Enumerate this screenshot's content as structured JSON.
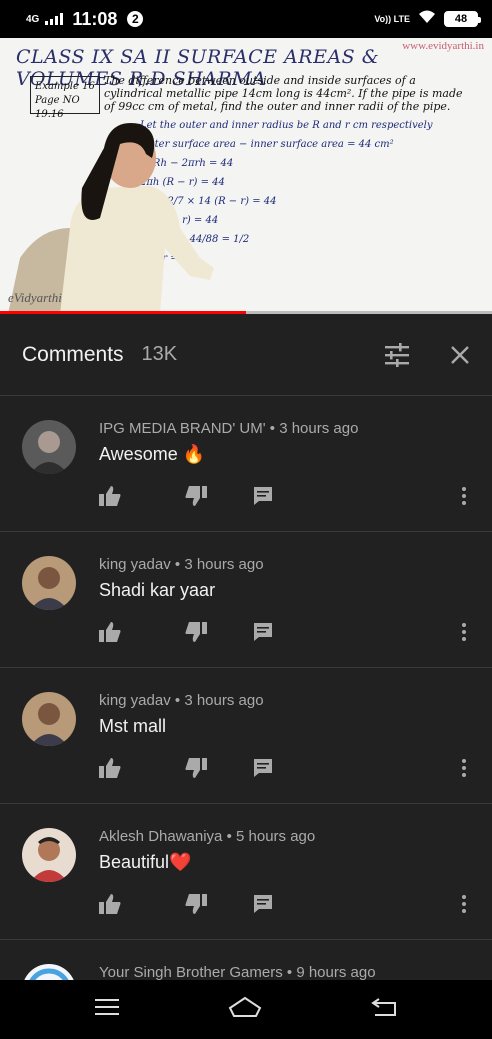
{
  "status_bar": {
    "network": "4G",
    "time": "11:08",
    "notification_count": "2",
    "volte": "Vo)) LTE",
    "battery": "48"
  },
  "video": {
    "board_title": "CLASS IX  SA II  SURFACE AREAS & VOLUMES  R.D SHARMA",
    "watermark": "www.evidyarthi.in",
    "example_label": "Example 16",
    "page_label": "Page NO 19.16",
    "question": "The difference between outside and inside surfaces of a cylindrical metallic pipe 14cm long is 44cm². If the pipe is made of 99cc cm of metal, find the outer and inner radii of the pipe.",
    "work_lines": [
      "Let the outer and inner radius be R and r cm respectively",
      "Outer surface area − inner surface area = 44 cm²",
      "2πRh − 2πrh = 44",
      "2πh (R − r) = 44",
      "2 × 22/7 × 14 (R − r) = 44",
      "88 (R − r) = 44",
      "(R − r) = 44/88 = 1/2",
      "R − r = 1/2"
    ],
    "logo": "eVidyarthi",
    "progress": 0.5
  },
  "comments": {
    "title": "Comments",
    "count": "13K",
    "items": [
      {
        "author": "IPG MEDIA BRAND' UM'",
        "time": "3 hours ago",
        "text": "Awesome 🔥",
        "avatar_color": "#8a8a8a"
      },
      {
        "author": "king yadav",
        "time": "3 hours ago",
        "text": "Shadi kar yaar",
        "avatar_color": "#b89a78"
      },
      {
        "author": "king yadav",
        "time": "3 hours ago",
        "text": "Mst mall",
        "avatar_color": "#b89a78"
      },
      {
        "author": "Aklesh Dhawaniya",
        "time": "5 hours ago",
        "text": "Beautiful❤️",
        "avatar_color": "#c07860"
      },
      {
        "author": "Your Singh Brother Gamers",
        "time": "9 hours ago",
        "text": "",
        "avatar_color": "#4aa3e0"
      }
    ]
  },
  "colors": {
    "panel_bg": "#212121",
    "progress": "#ff0000",
    "meta_text": "#aaaaaa"
  }
}
